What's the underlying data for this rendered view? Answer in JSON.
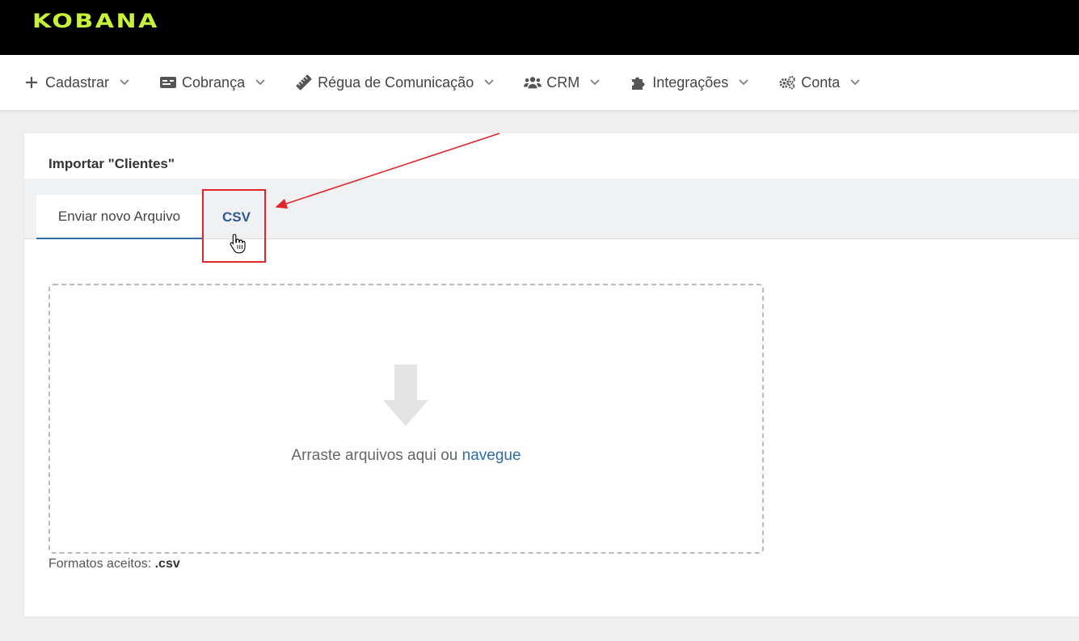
{
  "header": {
    "logo": "KOBANA",
    "logo_color": "#c6f33a"
  },
  "nav": {
    "items": [
      {
        "label": "Cadastrar",
        "icon": "plus-icon"
      },
      {
        "label": "Cobrança",
        "icon": "id-card-icon"
      },
      {
        "label": "Régua de Comunicação",
        "icon": "ruler-icon"
      },
      {
        "label": "CRM",
        "icon": "users-icon"
      },
      {
        "label": "Integrações",
        "icon": "puzzle-icon"
      },
      {
        "label": "Conta",
        "icon": "gears-icon"
      }
    ]
  },
  "page": {
    "title": "Importar \"Clientes\"",
    "tabs": [
      {
        "label": "Enviar novo Arquivo",
        "active": true
      },
      {
        "label": "CSV",
        "active": false
      }
    ],
    "dropzone": {
      "text": "Arraste arquivos aqui ou",
      "link": "navegue"
    },
    "formats_label": "Formatos aceitos:",
    "formats_value": ".csv"
  },
  "colors": {
    "accent": "#2e6ca8",
    "highlight": "#e0262b"
  }
}
